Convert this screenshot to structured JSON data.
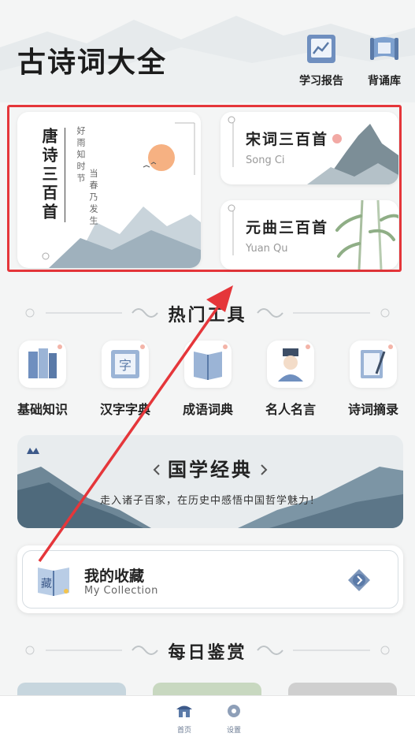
{
  "header": {
    "title": "古诗词大全",
    "buttons": [
      {
        "label": "学习报告",
        "icon": "report-chart-icon"
      },
      {
        "label": "背诵库",
        "icon": "scroll-icon"
      }
    ]
  },
  "featured": {
    "tang": {
      "title": "唐诗三百首",
      "sub1": "好雨知时节",
      "sub2": "当春乃发生"
    },
    "song": {
      "title": "宋词三百首",
      "sub": "Song Ci"
    },
    "yuan": {
      "title": "元曲三百首",
      "sub": "Yuan Qu"
    }
  },
  "sections": {
    "tools_title": "热门工具",
    "daily_title": "每日鉴赏"
  },
  "tools": [
    {
      "label": "基础知识",
      "icon": "books-icon"
    },
    {
      "label": "汉字字典",
      "icon": "dictionary-icon"
    },
    {
      "label": "成语词典",
      "icon": "idiom-book-icon"
    },
    {
      "label": "名人名言",
      "icon": "scholar-icon"
    },
    {
      "label": "诗词摘录",
      "icon": "excerpt-brush-icon"
    }
  ],
  "banner": {
    "title": "国学经典",
    "subtitle": "走入诸子百家，在历史中感悟中国哲学魅力！"
  },
  "collection": {
    "title": "我的收藏",
    "subtitle": "My Collection",
    "badge": "藏"
  },
  "nav": {
    "home": "首页",
    "settings": "设置"
  },
  "colors": {
    "highlight_border": "#e5363a",
    "accent_blue": "#5a7aa8"
  }
}
